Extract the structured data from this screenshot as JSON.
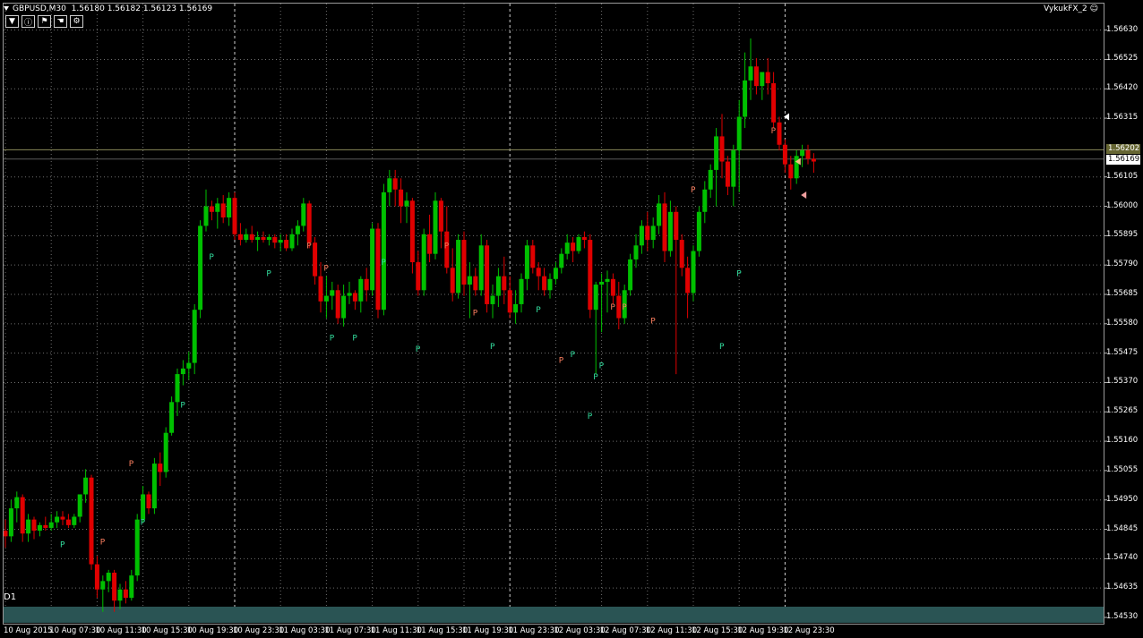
{
  "chart": {
    "symbol": "GBPUSD,M30",
    "bid": "1.56180",
    "high": "1.56182",
    "low": "1.56123",
    "close": "1.56169",
    "indicator": "VykukFX_2",
    "timeframe_label": "D1",
    "current_price": "1.56169",
    "line_price": "1.56202",
    "colors": {
      "bull": "#00c000",
      "bear": "#e00000",
      "p_high": "#ff8060",
      "p_low": "#33e0a0",
      "grid": "#6e6e6e",
      "bg": "#000000",
      "band": "#2a5454"
    }
  },
  "toolbar": {
    "buttons": [
      "dropdown",
      "info",
      "flag",
      "hand",
      "settings"
    ]
  },
  "price_axis": [
    "1.56630",
    "1.56525",
    "1.56420",
    "1.56315",
    "1.56105",
    "1.56000",
    "1.55895",
    "1.55790",
    "1.55685",
    "1.55580",
    "1.55475",
    "1.55370",
    "1.55265",
    "1.55160",
    "1.55055",
    "1.54950",
    "1.54845",
    "1.54740",
    "1.54635",
    "1.54530"
  ],
  "time_axis": [
    "10 Aug 2015",
    "10 Aug 07:30",
    "10 Aug 11:30",
    "10 Aug 15:30",
    "10 Aug 19:30",
    "10 Aug 23:30",
    "11 Aug 03:30",
    "11 Aug 07:30",
    "11 Aug 11:30",
    "11 Aug 15:30",
    "11 Aug 19:30",
    "11 Aug 23:30",
    "12 Aug 03:30",
    "12 Aug 07:30",
    "12 Aug 11:30",
    "12 Aug 15:30",
    "12 Aug 19:30",
    "12 Aug 23:30"
  ],
  "chart_data": {
    "type": "candlestick",
    "ylim": [
      1.5453,
      1.5668
    ],
    "bars_per_label": 8,
    "candles": [
      [
        1.5484,
        1.5488,
        1.5478,
        1.5482
      ],
      [
        1.5482,
        1.5495,
        1.548,
        1.5492
      ],
      [
        1.5492,
        1.5498,
        1.5487,
        1.5496
      ],
      [
        1.5496,
        1.5497,
        1.548,
        1.5483
      ],
      [
        1.5483,
        1.549,
        1.548,
        1.5488
      ],
      [
        1.5488,
        1.5489,
        1.5481,
        1.5484
      ],
      [
        1.5484,
        1.5487,
        1.5482,
        1.5486
      ],
      [
        1.5486,
        1.5489,
        1.5484,
        1.5485
      ],
      [
        1.5485,
        1.549,
        1.5484,
        1.5487
      ],
      [
        1.5487,
        1.5491,
        1.5485,
        1.5489
      ],
      [
        1.5489,
        1.5491,
        1.5486,
        1.5488
      ],
      [
        1.5488,
        1.549,
        1.5485,
        1.5486
      ],
      [
        1.5486,
        1.549,
        1.5485,
        1.5489
      ],
      [
        1.5489,
        1.5494,
        1.5487,
        1.5497
      ],
      [
        1.5497,
        1.5506,
        1.5494,
        1.5503
      ],
      [
        1.5503,
        1.5504,
        1.547,
        1.5472
      ],
      [
        1.5472,
        1.5475,
        1.546,
        1.5463
      ],
      [
        1.5463,
        1.5468,
        1.5455,
        1.5466
      ],
      [
        1.5466,
        1.547,
        1.5462,
        1.5469
      ],
      [
        1.5469,
        1.547,
        1.5455,
        1.5459
      ],
      [
        1.5459,
        1.5465,
        1.5456,
        1.5463
      ],
      [
        1.5463,
        1.5466,
        1.5458,
        1.546
      ],
      [
        1.546,
        1.547,
        1.5459,
        1.5468
      ],
      [
        1.5468,
        1.549,
        1.5466,
        1.5488
      ],
      [
        1.5488,
        1.55,
        1.5487,
        1.5497
      ],
      [
        1.5497,
        1.5498,
        1.549,
        1.5492
      ],
      [
        1.5492,
        1.551,
        1.549,
        1.5508
      ],
      [
        1.5508,
        1.5512,
        1.55,
        1.5505
      ],
      [
        1.5505,
        1.5521,
        1.5503,
        1.5519
      ],
      [
        1.5519,
        1.5532,
        1.5518,
        1.553
      ],
      [
        1.553,
        1.5542,
        1.5525,
        1.554
      ],
      [
        1.554,
        1.5545,
        1.5536,
        1.5542
      ],
      [
        1.5542,
        1.5548,
        1.5538,
        1.5544
      ],
      [
        1.5544,
        1.5565,
        1.554,
        1.5563
      ],
      [
        1.5563,
        1.5595,
        1.556,
        1.5593
      ],
      [
        1.5593,
        1.5606,
        1.5591,
        1.56
      ],
      [
        1.56,
        1.5602,
        1.5595,
        1.5598
      ],
      [
        1.5598,
        1.5603,
        1.5592,
        1.5601
      ],
      [
        1.5601,
        1.5604,
        1.5594,
        1.5596
      ],
      [
        1.5596,
        1.5605,
        1.5593,
        1.5603
      ],
      [
        1.5603,
        1.5605,
        1.5588,
        1.559
      ],
      [
        1.559,
        1.5594,
        1.5586,
        1.5588
      ],
      [
        1.5588,
        1.5592,
        1.5587,
        1.559
      ],
      [
        1.559,
        1.5593,
        1.5587,
        1.5588
      ],
      [
        1.5588,
        1.5591,
        1.5584,
        1.5589
      ],
      [
        1.5589,
        1.5591,
        1.5587,
        1.5588
      ],
      [
        1.5588,
        1.559,
        1.5586,
        1.5589
      ],
      [
        1.5589,
        1.559,
        1.5585,
        1.5587
      ],
      [
        1.5587,
        1.559,
        1.5584,
        1.5588
      ],
      [
        1.5588,
        1.559,
        1.5584,
        1.5585
      ],
      [
        1.5585,
        1.5592,
        1.5584,
        1.559
      ],
      [
        1.559,
        1.5595,
        1.5586,
        1.5593
      ],
      [
        1.5593,
        1.5603,
        1.5591,
        1.5601
      ],
      [
        1.5601,
        1.5602,
        1.5585,
        1.5587
      ],
      [
        1.5587,
        1.5589,
        1.5572,
        1.5575
      ],
      [
        1.5575,
        1.558,
        1.5562,
        1.5566
      ],
      [
        1.5566,
        1.5575,
        1.556,
        1.5568
      ],
      [
        1.5568,
        1.5573,
        1.5563,
        1.557
      ],
      [
        1.557,
        1.5572,
        1.5558,
        1.556
      ],
      [
        1.556,
        1.5572,
        1.5557,
        1.5568
      ],
      [
        1.5568,
        1.5573,
        1.5565,
        1.5569
      ],
      [
        1.5569,
        1.557,
        1.5563,
        1.5566
      ],
      [
        1.5566,
        1.5575,
        1.5562,
        1.5574
      ],
      [
        1.5574,
        1.5578,
        1.5566,
        1.557
      ],
      [
        1.557,
        1.5594,
        1.5568,
        1.5592
      ],
      [
        1.5592,
        1.5594,
        1.556,
        1.5563
      ],
      [
        1.5563,
        1.5608,
        1.5561,
        1.5605
      ],
      [
        1.5605,
        1.5613,
        1.56,
        1.561
      ],
      [
        1.561,
        1.5613,
        1.56,
        1.5606
      ],
      [
        1.5606,
        1.561,
        1.5594,
        1.56
      ],
      [
        1.56,
        1.5605,
        1.5594,
        1.5602
      ],
      [
        1.5602,
        1.5603,
        1.5576,
        1.558
      ],
      [
        1.558,
        1.5584,
        1.5568,
        1.557
      ],
      [
        1.557,
        1.5592,
        1.5568,
        1.559
      ],
      [
        1.559,
        1.5597,
        1.558,
        1.5583
      ],
      [
        1.5583,
        1.5605,
        1.5581,
        1.5602
      ],
      [
        1.5602,
        1.5603,
        1.5585,
        1.5591
      ],
      [
        1.5591,
        1.56,
        1.5576,
        1.5578
      ],
      [
        1.5578,
        1.5585,
        1.5566,
        1.5569
      ],
      [
        1.5569,
        1.559,
        1.5567,
        1.5588
      ],
      [
        1.5588,
        1.5591,
        1.5568,
        1.5572
      ],
      [
        1.5572,
        1.558,
        1.556,
        1.5575
      ],
      [
        1.5575,
        1.5578,
        1.5568,
        1.557
      ],
      [
        1.557,
        1.559,
        1.5568,
        1.5586
      ],
      [
        1.5586,
        1.5588,
        1.5562,
        1.5565
      ],
      [
        1.5565,
        1.5572,
        1.556,
        1.5568
      ],
      [
        1.5568,
        1.5578,
        1.5564,
        1.5575
      ],
      [
        1.5575,
        1.5582,
        1.5565,
        1.557
      ],
      [
        1.557,
        1.5575,
        1.556,
        1.5562
      ],
      [
        1.5562,
        1.557,
        1.5558,
        1.5565
      ],
      [
        1.5565,
        1.5576,
        1.5562,
        1.5574
      ],
      [
        1.5574,
        1.5588,
        1.557,
        1.5586
      ],
      [
        1.5586,
        1.5588,
        1.5576,
        1.5578
      ],
      [
        1.5578,
        1.558,
        1.557,
        1.5575
      ],
      [
        1.5575,
        1.5578,
        1.5568,
        1.557
      ],
      [
        1.557,
        1.5576,
        1.5567,
        1.5574
      ],
      [
        1.5574,
        1.558,
        1.5572,
        1.5578
      ],
      [
        1.5578,
        1.5585,
        1.5576,
        1.5583
      ],
      [
        1.5583,
        1.559,
        1.5581,
        1.5587
      ],
      [
        1.5587,
        1.5589,
        1.558,
        1.5584
      ],
      [
        1.5584,
        1.559,
        1.5583,
        1.5589
      ],
      [
        1.5589,
        1.5591,
        1.5585,
        1.5588
      ],
      [
        1.5588,
        1.559,
        1.556,
        1.5563
      ],
      [
        1.5563,
        1.5573,
        1.554,
        1.5572
      ],
      [
        1.5572,
        1.5576,
        1.5555,
        1.5573
      ],
      [
        1.5573,
        1.5577,
        1.5562,
        1.5574
      ],
      [
        1.5574,
        1.5576,
        1.5565,
        1.5568
      ],
      [
        1.5568,
        1.5573,
        1.5556,
        1.556
      ],
      [
        1.556,
        1.5572,
        1.5558,
        1.557
      ],
      [
        1.557,
        1.5583,
        1.5568,
        1.5581
      ],
      [
        1.5581,
        1.559,
        1.5578,
        1.5586
      ],
      [
        1.5586,
        1.5595,
        1.5583,
        1.5593
      ],
      [
        1.5593,
        1.5598,
        1.5584,
        1.5588
      ],
      [
        1.5588,
        1.5596,
        1.5585,
        1.5593
      ],
      [
        1.5593,
        1.5604,
        1.559,
        1.5601
      ],
      [
        1.5601,
        1.5605,
        1.558,
        1.5584
      ],
      [
        1.5584,
        1.5602,
        1.5582,
        1.5598
      ],
      [
        1.5598,
        1.56,
        1.554,
        1.5588
      ],
      [
        1.5588,
        1.559,
        1.5575,
        1.5578
      ],
      [
        1.5578,
        1.5582,
        1.556,
        1.5569
      ],
      [
        1.5569,
        1.5586,
        1.5566,
        1.5584
      ],
      [
        1.5584,
        1.56,
        1.5582,
        1.5598
      ],
      [
        1.5598,
        1.5609,
        1.5594,
        1.5606
      ],
      [
        1.5606,
        1.5615,
        1.5603,
        1.5613
      ],
      [
        1.5613,
        1.5628,
        1.56,
        1.5625
      ],
      [
        1.5625,
        1.5633,
        1.561,
        1.5616
      ],
      [
        1.5616,
        1.5618,
        1.5604,
        1.5607
      ],
      [
        1.5607,
        1.5622,
        1.56,
        1.562
      ],
      [
        1.562,
        1.5638,
        1.5605,
        1.5632
      ],
      [
        1.5632,
        1.5655,
        1.5628,
        1.5645
      ],
      [
        1.5645,
        1.566,
        1.5638,
        1.565
      ],
      [
        1.565,
        1.5653,
        1.564,
        1.5643
      ],
      [
        1.5643,
        1.5647,
        1.5638,
        1.5648
      ],
      [
        1.5648,
        1.5653,
        1.564,
        1.5644
      ],
      [
        1.5644,
        1.5648,
        1.5628,
        1.563
      ],
      [
        1.563,
        1.5632,
        1.562,
        1.5622
      ],
      [
        1.5622,
        1.5624,
        1.5612,
        1.5615
      ],
      [
        1.5615,
        1.5618,
        1.5606,
        1.561
      ],
      [
        1.561,
        1.562,
        1.5608,
        1.5618
      ],
      [
        1.5618,
        1.5622,
        1.5614,
        1.562
      ],
      [
        1.562,
        1.5622,
        1.5615,
        1.5617
      ],
      [
        1.5617,
        1.5619,
        1.5612,
        1.5616
      ]
    ],
    "p_markers": [
      {
        "bar": 10,
        "price": 1.5479,
        "type": "low"
      },
      {
        "bar": 17,
        "price": 1.548,
        "type": "high"
      },
      {
        "bar": 22,
        "price": 1.5508,
        "type": "high"
      },
      {
        "bar": 24,
        "price": 1.5487,
        "type": "low"
      },
      {
        "bar": 31,
        "price": 1.5529,
        "type": "low"
      },
      {
        "bar": 36,
        "price": 1.5582,
        "type": "low"
      },
      {
        "bar": 46,
        "price": 1.5576,
        "type": "low"
      },
      {
        "bar": 53,
        "price": 1.5586,
        "type": "high"
      },
      {
        "bar": 56,
        "price": 1.5578,
        "type": "high"
      },
      {
        "bar": 57,
        "price": 1.5553,
        "type": "low"
      },
      {
        "bar": 61,
        "price": 1.5553,
        "type": "low"
      },
      {
        "bar": 66,
        "price": 1.558,
        "type": "low"
      },
      {
        "bar": 72,
        "price": 1.5549,
        "type": "low"
      },
      {
        "bar": 77,
        "price": 1.5586,
        "type": "high"
      },
      {
        "bar": 82,
        "price": 1.5562,
        "type": "high"
      },
      {
        "bar": 85,
        "price": 1.555,
        "type": "low"
      },
      {
        "bar": 93,
        "price": 1.5563,
        "type": "low"
      },
      {
        "bar": 97,
        "price": 1.5545,
        "type": "high"
      },
      {
        "bar": 99,
        "price": 1.5547,
        "type": "low"
      },
      {
        "bar": 102,
        "price": 1.5525,
        "type": "low"
      },
      {
        "bar": 103,
        "price": 1.5539,
        "type": "low"
      },
      {
        "bar": 104,
        "price": 1.5543,
        "type": "low"
      },
      {
        "bar": 106,
        "price": 1.5564,
        "type": "high"
      },
      {
        "bar": 108,
        "price": 1.5564,
        "type": "high"
      },
      {
        "bar": 113,
        "price": 1.5559,
        "type": "high"
      },
      {
        "bar": 120,
        "price": 1.5606,
        "type": "high"
      },
      {
        "bar": 125,
        "price": 1.555,
        "type": "low"
      },
      {
        "bar": 128,
        "price": 1.5576,
        "type": "low"
      },
      {
        "bar": 134,
        "price": 1.5627,
        "type": "high"
      }
    ]
  }
}
